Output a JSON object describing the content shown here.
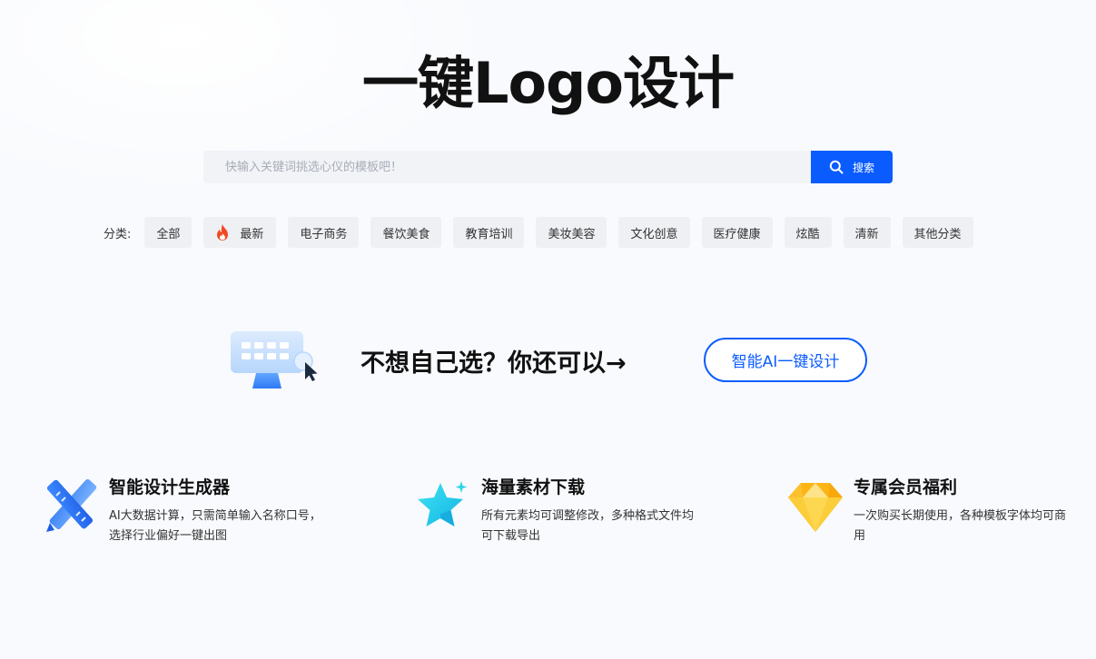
{
  "hero": {
    "title": "一键Logo设计"
  },
  "search": {
    "placeholder": "快输入关键词挑选心仪的模板吧！",
    "value": "",
    "button_label": "搜索"
  },
  "categories": {
    "label": "分类:",
    "items": [
      "全部",
      "最新",
      "电子商务",
      "餐饮美食",
      "教育培训",
      "美妆美容",
      "文化创意",
      "医疗健康",
      "炫酷",
      "清新",
      "其他分类"
    ]
  },
  "promo": {
    "text": "不想自己选？你还可以→",
    "button_label": "智能AI一键设计"
  },
  "features": [
    {
      "title": "智能设计生成器",
      "desc": "AI大数据计算，只需简单输入名称口号，选择行业偏好一键出图",
      "icon": "ruler-pencil-icon"
    },
    {
      "title": "海量素材下载",
      "desc": "所有元素均可调整修改，多种格式文件均可下载导出",
      "icon": "star-icon"
    },
    {
      "title": "专属会员福利",
      "desc": "一次购买长期使用，各种模板字体均可商用",
      "icon": "diamond-icon"
    }
  ],
  "colors": {
    "accent": "#0a5cff",
    "chip_bg": "#eef0f3",
    "hot": "#f04a24"
  }
}
